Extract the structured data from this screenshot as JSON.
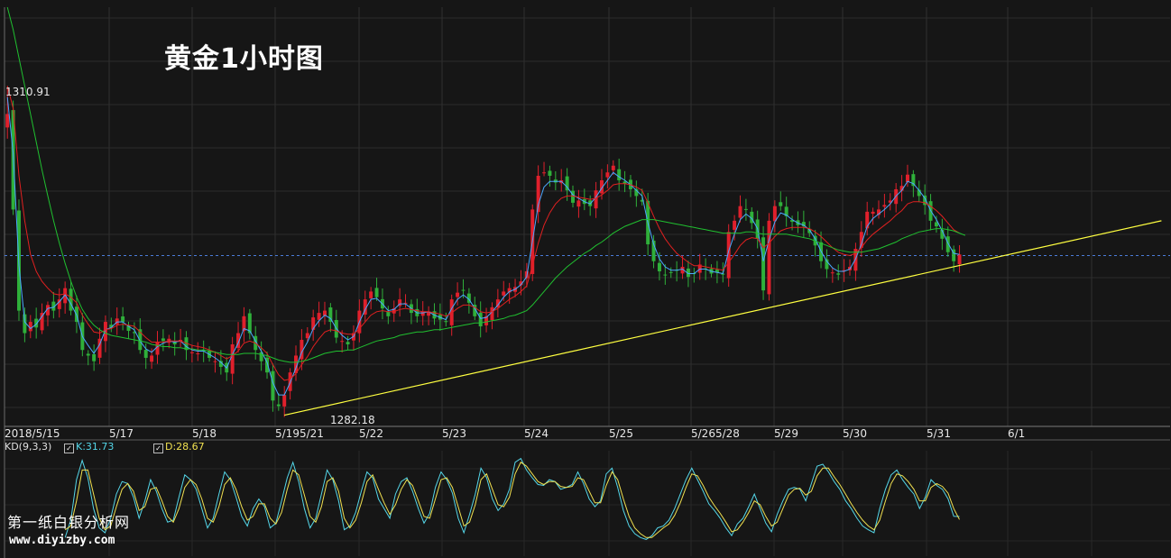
{
  "title": "黄金1小时图",
  "watermark": {
    "name": "第一纸白银分析网",
    "url": "www.diyizby.com"
  },
  "chart_data": {
    "type": "candlestick",
    "instrument_label": "黄金1小时图",
    "x_dates": [
      "2018/5/15",
      "5/17",
      "5/18",
      "5/195/21",
      "5/22",
      "5/23",
      "5/24",
      "5/25",
      "5/265/28",
      "5/29",
      "5/30",
      "5/31",
      "6/1"
    ],
    "price_annotations": {
      "high": "1310.91",
      "low": "1282.18"
    },
    "high_value": 1310.91,
    "low_value": 1282.18,
    "current_level": 1295.9,
    "close_series": [
      1308.5,
      1300,
      1291,
      1289,
      1290,
      1289.5,
      1290.8,
      1291.5,
      1291,
      1292,
      1293,
      1291,
      1290,
      1287.5,
      1287,
      1286.5,
      1288.5,
      1290,
      1289.5,
      1290.3,
      1290,
      1289.2,
      1289,
      1287.5,
      1286.8,
      1287,
      1288.2,
      1288.3,
      1288.5,
      1288,
      1288.4,
      1287.5,
      1287.3,
      1287.2,
      1287.4,
      1286.8,
      1286.5,
      1286,
      1285.5,
      1288,
      1289,
      1290.5,
      1289,
      1287.5,
      1286.5,
      1285.5,
      1283,
      1282.5,
      1283.5,
      1285.5,
      1287,
      1288.4,
      1289,
      1290.4,
      1290.8,
      1291,
      1290,
      1288.6,
      1288.3,
      1288,
      1289,
      1291,
      1292,
      1292.7,
      1292.2,
      1291.2,
      1290.5,
      1291.2,
      1292,
      1291.7,
      1290.8,
      1290.5,
      1290.9,
      1290.9,
      1290.3,
      1290.2,
      1290,
      1292,
      1292.6,
      1292.8,
      1291.7,
      1290.5,
      1289.6,
      1290.5,
      1291.3,
      1292,
      1292.7,
      1293,
      1293.1,
      1293.6,
      1294.5,
      1300,
      1303,
      1303.3,
      1303,
      1302.4,
      1302.6,
      1301.7,
      1300.6,
      1300.8,
      1300.5,
      1300.3,
      1301.7,
      1302.6,
      1303.3,
      1303.9,
      1302.6,
      1302.3,
      1301.8,
      1301.2,
      1300.7,
      1296.9,
      1295.4,
      1294.5,
      1294.2,
      1294.4,
      1294.6,
      1294.9,
      1294,
      1294.3,
      1295.1,
      1294.7,
      1294.3,
      1294.4,
      1294.2,
      1298,
      1299,
      1300.3,
      1300,
      1298.8,
      1297.4,
      1292.8,
      1299,
      1300.3,
      1300.3,
      1299.4,
      1298.9,
      1298.6,
      1298.5,
      1297.9,
      1296.8,
      1295.4,
      1294.7,
      1294.4,
      1294.2,
      1294.6,
      1294.9,
      1296.5,
      1298,
      1299.8,
      1299.8,
      1300,
      1300.4,
      1300.8,
      1301.8,
      1302.1,
      1303.1,
      1302.1,
      1301.2,
      1300.4,
      1299,
      1298.5,
      1297.4,
      1296.2,
      1295.4,
      1296
    ],
    "ma_series": [
      {
        "color": "#4aa8ff",
        "values": [
          1310,
          1305,
          1295,
          1290,
          1289.4,
          1289.8,
          1290.5,
          1291.2,
          1291.3,
          1291.8,
          1292.4,
          1291.6,
          1290.6,
          1288.7,
          1287.9,
          1287.2,
          1288,
          1289.3,
          1289.5,
          1290,
          1290,
          1289.6,
          1289.3,
          1288.3,
          1287.6,
          1287.3,
          1287.8,
          1288.1,
          1288.3,
          1288.2,
          1288.3,
          1287.8,
          1287.5,
          1287.4,
          1287.4,
          1287.1,
          1286.8,
          1286.4,
          1285.9,
          1287.1,
          1288.1,
          1289.4,
          1289.2,
          1288.3,
          1287.4,
          1286.4,
          1284.6,
          1283.5,
          1283.5,
          1284.6,
          1285.9,
          1287.3,
          1288.2,
          1289.4,
          1290.1,
          1290.6,
          1290.3,
          1289.4,
          1288.8,
          1288.4,
          1288.7,
          1290,
          1291.1,
          1292,
          1292.1,
          1291.6,
          1291,
          1291.1,
          1291.6,
          1291.6,
          1291.2,
          1290.8,
          1290.8,
          1290.9,
          1290.6,
          1290.4,
          1290.2,
          1291.2,
          1292,
          1292.4,
          1292,
          1291.2,
          1290.3,
          1290.4,
          1290.9,
          1291.5,
          1292.2,
          1292.7,
          1292.9,
          1293.3,
          1294,
          1297.2,
          1300.4,
          1302,
          1302.5,
          1302.5,
          1302.5,
          1302,
          1301.3,
          1301,
          1300.7,
          1300.5,
          1301.1,
          1301.9,
          1302.6,
          1303.3,
          1302.9,
          1302.6,
          1302.2,
          1301.7,
          1301.2,
          1298.8,
          1296.9,
          1295.6,
          1294.9,
          1294.6,
          1294.6,
          1294.7,
          1294.3,
          1294.3,
          1294.7,
          1294.7,
          1294.5,
          1294.4,
          1294.3,
          1296.3,
          1297.8,
          1299.1,
          1299.6,
          1299.2,
          1298.3,
          1295.4,
          1297.3,
          1298.9,
          1299.7,
          1299.5,
          1299.1,
          1298.8,
          1298.6,
          1298.2,
          1297.4,
          1296.3,
          1295.4,
          1294.8,
          1294.5,
          1294.5,
          1294.7,
          1295.6,
          1296.9,
          1298.5,
          1299.2,
          1299.6,
          1300,
          1300.5,
          1301.2,
          1301.7,
          1302.5,
          1302.3,
          1301.7,
          1301,
          1299.9,
          1299.1,
          1298.1,
          1297,
          1296.1,
          1296
        ]
      },
      {
        "color": "#e02020",
        "values": [
          1311,
          1309,
          1303,
          1299,
          1296,
          1294.5,
          1293.6,
          1293,
          1292.5,
          1292.4,
          1292.5,
          1292.2,
          1291.7,
          1290.6,
          1289.8,
          1289.1,
          1289,
          1289.3,
          1289.4,
          1289.7,
          1289.8,
          1289.7,
          1289.6,
          1289.1,
          1288.6,
          1288.2,
          1288.2,
          1288.2,
          1288.3,
          1288.3,
          1288.3,
          1288.1,
          1287.9,
          1287.8,
          1287.7,
          1287.5,
          1287.3,
          1287,
          1286.7,
          1287,
          1287.4,
          1288.1,
          1288.3,
          1288.1,
          1287.7,
          1287.2,
          1286.2,
          1285.3,
          1284.8,
          1284.9,
          1285.4,
          1286.2,
          1286.9,
          1287.8,
          1288.5,
          1289.1,
          1289.3,
          1289.2,
          1289,
          1288.9,
          1288.9,
          1289.4,
          1290,
          1290.6,
          1290.9,
          1291,
          1290.9,
          1290.9,
          1291.1,
          1291.2,
          1291.1,
          1291,
          1290.9,
          1290.9,
          1290.8,
          1290.7,
          1290.5,
          1290.8,
          1291.2,
          1291.5,
          1291.5,
          1291.3,
          1290.9,
          1290.8,
          1290.9,
          1291.2,
          1291.6,
          1292,
          1292.3,
          1292.7,
          1293.2,
          1295,
          1297,
          1298.6,
          1299.7,
          1300.5,
          1301,
          1301.2,
          1301.2,
          1301.1,
          1301,
          1300.9,
          1301,
          1301.3,
          1301.7,
          1302.2,
          1302.3,
          1302.3,
          1302.2,
          1302,
          1301.7,
          1300.6,
          1299.4,
          1298.3,
          1297.4,
          1296.7,
          1296.1,
          1295.7,
          1295.3,
          1295,
          1295,
          1294.9,
          1294.8,
          1294.7,
          1294.6,
          1295.3,
          1296,
          1296.8,
          1297.3,
          1297.5,
          1297.4,
          1296.6,
          1297,
          1297.6,
          1298.1,
          1298.3,
          1298.4,
          1298.4,
          1298.4,
          1298.3,
          1298,
          1297.6,
          1297.1,
          1296.6,
          1296.2,
          1296,
          1295.9,
          1296.1,
          1296.6,
          1297.3,
          1297.8,
          1298.2,
          1298.6,
          1299,
          1299.5,
          1299.9,
          1300.5,
          1300.7,
          1300.7,
          1300.6,
          1300.3,
          1299.9,
          1299.4,
          1298.8,
          1298.2,
          1297.9
        ]
      },
      {
        "color": "#20c030",
        "values": [
          1318,
          1316,
          1313.5,
          1311,
          1308.5,
          1306,
          1303.5,
          1301.2,
          1299,
          1297,
          1295.2,
          1293.6,
          1292.2,
          1291.1,
          1290.3,
          1289.7,
          1289.3,
          1289,
          1288.8,
          1288.7,
          1288.6,
          1288.5,
          1288.4,
          1288.3,
          1288.2,
          1288,
          1287.9,
          1287.8,
          1287.8,
          1287.7,
          1287.7,
          1287.6,
          1287.6,
          1287.5,
          1287.5,
          1287.4,
          1287.3,
          1287.2,
          1287.1,
          1287.1,
          1287.1,
          1287.2,
          1287.2,
          1287.2,
          1287.1,
          1287,
          1286.8,
          1286.6,
          1286.5,
          1286.4,
          1286.4,
          1286.5,
          1286.6,
          1286.8,
          1287,
          1287.2,
          1287.3,
          1287.4,
          1287.4,
          1287.5,
          1287.5,
          1287.7,
          1287.9,
          1288.1,
          1288.3,
          1288.4,
          1288.5,
          1288.6,
          1288.8,
          1288.9,
          1289,
          1289.1,
          1289.1,
          1289.2,
          1289.3,
          1289.3,
          1289.4,
          1289.5,
          1289.6,
          1289.7,
          1289.8,
          1289.9,
          1289.9,
          1290,
          1290.1,
          1290.2,
          1290.3,
          1290.5,
          1290.6,
          1290.8,
          1291,
          1291.5,
          1292.1,
          1292.7,
          1293.3,
          1293.9,
          1294.4,
          1294.9,
          1295.3,
          1295.7,
          1296.1,
          1296.4,
          1296.8,
          1297.1,
          1297.5,
          1297.9,
          1298.2,
          1298.5,
          1298.7,
          1298.9,
          1299.1,
          1299.1,
          1299.1,
          1299,
          1298.9,
          1298.8,
          1298.7,
          1298.6,
          1298.5,
          1298.4,
          1298.3,
          1298.2,
          1298.1,
          1298,
          1297.9,
          1297.9,
          1297.9,
          1297.9,
          1298,
          1298,
          1297.9,
          1297.8,
          1297.8,
          1297.8,
          1297.8,
          1297.8,
          1297.7,
          1297.6,
          1297.5,
          1297.4,
          1297.2,
          1297,
          1296.8,
          1296.6,
          1296.4,
          1296.3,
          1296.2,
          1296.2,
          1296.2,
          1296.3,
          1296.4,
          1296.5,
          1296.7,
          1296.9,
          1297.1,
          1297.4,
          1297.6,
          1297.8,
          1298,
          1298.1,
          1298.2,
          1298.3,
          1298.3,
          1298.2,
          1298.1,
          1297.9,
          1297.7
        ]
      }
    ],
    "trendline": {
      "color": "#ffff40",
      "from": {
        "index": 48,
        "value": 1281.7
      },
      "to": {
        "index": 200,
        "value": 1299.0
      }
    },
    "ylim": [
      1280.7,
      1318.0
    ],
    "xlim": [
      -0.5,
      201.5
    ],
    "grid": true,
    "indicator": {
      "name": "KD(9,3,3)",
      "k_label": "K:31.73",
      "d_label": "D:28.67",
      "k_color": "#54d6e8",
      "d_color": "#f0e050",
      "ylim": [
        0,
        100
      ],
      "k_values": [
        10,
        28,
        70,
        90,
        72,
        40,
        20,
        15,
        30,
        55,
        68,
        66,
        52,
        30,
        48,
        70,
        58,
        40,
        26,
        28,
        52,
        75,
        70,
        60,
        40,
        20,
        30,
        55,
        78,
        70,
        52,
        32,
        22,
        40,
        50,
        42,
        20,
        25,
        48,
        72,
        88,
        68,
        40,
        20,
        30,
        55,
        80,
        70,
        48,
        18,
        22,
        36,
        58,
        78,
        72,
        50,
        40,
        30,
        55,
        68,
        72,
        58,
        40,
        25,
        35,
        62,
        78,
        70,
        56,
        30,
        15,
        34,
        55,
        82,
        72,
        50,
        38,
        45,
        60,
        88,
        92,
        80,
        72,
        65,
        64,
        70,
        68,
        60,
        62,
        65,
        78,
        66,
        50,
        42,
        48,
        76,
        82,
        62,
        38,
        22,
        14,
        10,
        8,
        12,
        20,
        22,
        28,
        40,
        55,
        70,
        82,
        70,
        58,
        45,
        38,
        30,
        20,
        12,
        24,
        30,
        42,
        55,
        40,
        25,
        16,
        34,
        48,
        60,
        62,
        60,
        48,
        66,
        84,
        86,
        78,
        68,
        60,
        48,
        40,
        30,
        22,
        18,
        15,
        40,
        60,
        75,
        80,
        70,
        62,
        55,
        40,
        52,
        70,
        64,
        60,
        50,
        32,
        31.73
      ],
      "d_values": [
        18,
        22,
        48,
        80,
        80,
        55,
        30,
        18,
        22,
        42,
        60,
        66,
        58,
        38,
        42,
        60,
        62,
        48,
        32,
        26,
        40,
        62,
        70,
        65,
        50,
        30,
        26,
        42,
        65,
        72,
        60,
        42,
        28,
        32,
        45,
        45,
        30,
        24,
        36,
        60,
        80,
        75,
        54,
        32,
        26,
        42,
        68,
        72,
        58,
        30,
        20,
        28,
        46,
        68,
        75,
        60,
        46,
        34,
        44,
        60,
        70,
        64,
        48,
        32,
        30,
        50,
        70,
        72,
        62,
        42,
        22,
        26,
        44,
        70,
        76,
        60,
        44,
        42,
        52,
        76,
        88,
        84,
        76,
        68,
        65,
        68,
        68,
        63,
        62,
        63,
        72,
        70,
        58,
        46,
        46,
        64,
        78,
        70,
        50,
        32,
        20,
        14,
        10,
        10,
        15,
        20,
        24,
        33,
        46,
        62,
        76,
        74,
        64,
        52,
        43,
        35,
        26,
        16,
        18,
        26,
        36,
        48,
        44,
        32,
        22,
        26,
        40,
        54,
        60,
        61,
        54,
        58,
        74,
        82,
        82,
        73,
        65,
        55,
        45,
        36,
        28,
        22,
        18,
        28,
        48,
        66,
        76,
        74,
        68,
        60,
        48,
        48,
        62,
        66,
        63,
        56,
        40,
        28.67
      ]
    }
  }
}
